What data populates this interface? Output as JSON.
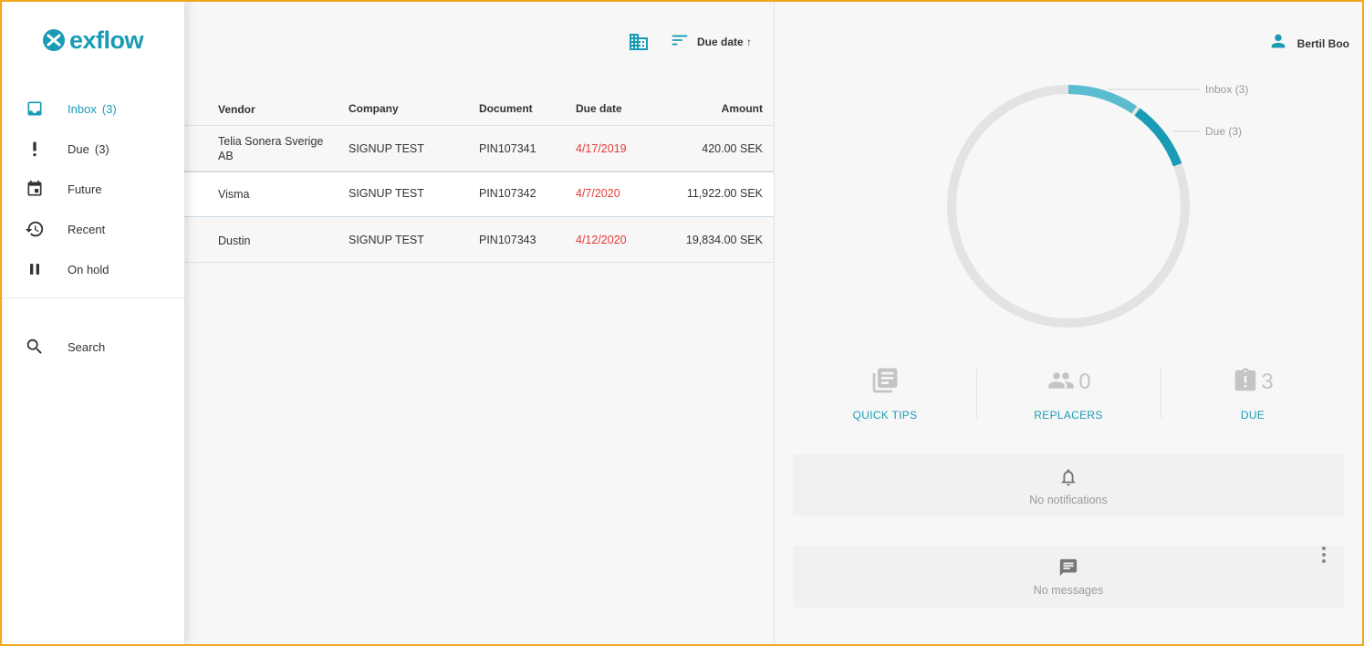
{
  "app": {
    "logo_text": "exflow",
    "brand_color": "#1a9bb5",
    "overdue_color": "#e53935"
  },
  "sidebar": {
    "items": [
      {
        "label": "Inbox",
        "count": "(3)",
        "icon": "inbox-icon",
        "active": true
      },
      {
        "label": "Due",
        "count": "(3)",
        "icon": "exclamation-icon",
        "active": false
      },
      {
        "label": "Future",
        "count": "",
        "icon": "calendar-icon",
        "active": false
      },
      {
        "label": "Recent",
        "count": "",
        "icon": "history-icon",
        "active": false
      },
      {
        "label": "On hold",
        "count": "",
        "icon": "pause-icon",
        "active": false
      },
      {
        "label": "Search",
        "count": "",
        "icon": "search-icon",
        "active": false
      }
    ]
  },
  "toolbar": {
    "company_icon": "building-icon",
    "sort_icon": "sort-icon",
    "sort_label": "Due date ↑"
  },
  "table": {
    "columns": [
      "Vendor",
      "Company",
      "Document",
      "Due date",
      "Amount"
    ],
    "rows": [
      {
        "vendor": "Telia Sonera Sverige AB",
        "company": "SIGNUP TEST",
        "document": "PIN107341",
        "due_date": "4/17/2019",
        "amount": "420.00 SEK"
      },
      {
        "vendor": "Visma",
        "company": "SIGNUP TEST",
        "document": "PIN107342",
        "due_date": "4/7/2020",
        "amount": "11,922.00 SEK"
      },
      {
        "vendor": "Dustin",
        "company": "SIGNUP TEST",
        "document": "PIN107343",
        "due_date": "4/12/2020",
        "amount": "19,834.00 SEK"
      }
    ]
  },
  "user": {
    "name": "Bertil Boo",
    "icon": "person-icon"
  },
  "chart_data": {
    "type": "pie",
    "style": "donut",
    "series": [
      {
        "name": "Inbox (3)",
        "color": "#5bbcd0"
      },
      {
        "name": "Due (3)",
        "color": "#1a9bb5"
      }
    ],
    "track_color": "#e3e3e3"
  },
  "stats": [
    {
      "label": "QUICK TIPS",
      "value": "",
      "icon": "book-icon"
    },
    {
      "label": "REPLACERS",
      "value": "0",
      "icon": "people-icon"
    },
    {
      "label": "DUE",
      "value": "3",
      "icon": "clipboard-alert-icon"
    }
  ],
  "notifications": {
    "text": "No notifications",
    "icon": "bell-icon"
  },
  "messages": {
    "text": "No messages",
    "icon": "message-icon",
    "menu_icon": "more-vertical-icon"
  }
}
